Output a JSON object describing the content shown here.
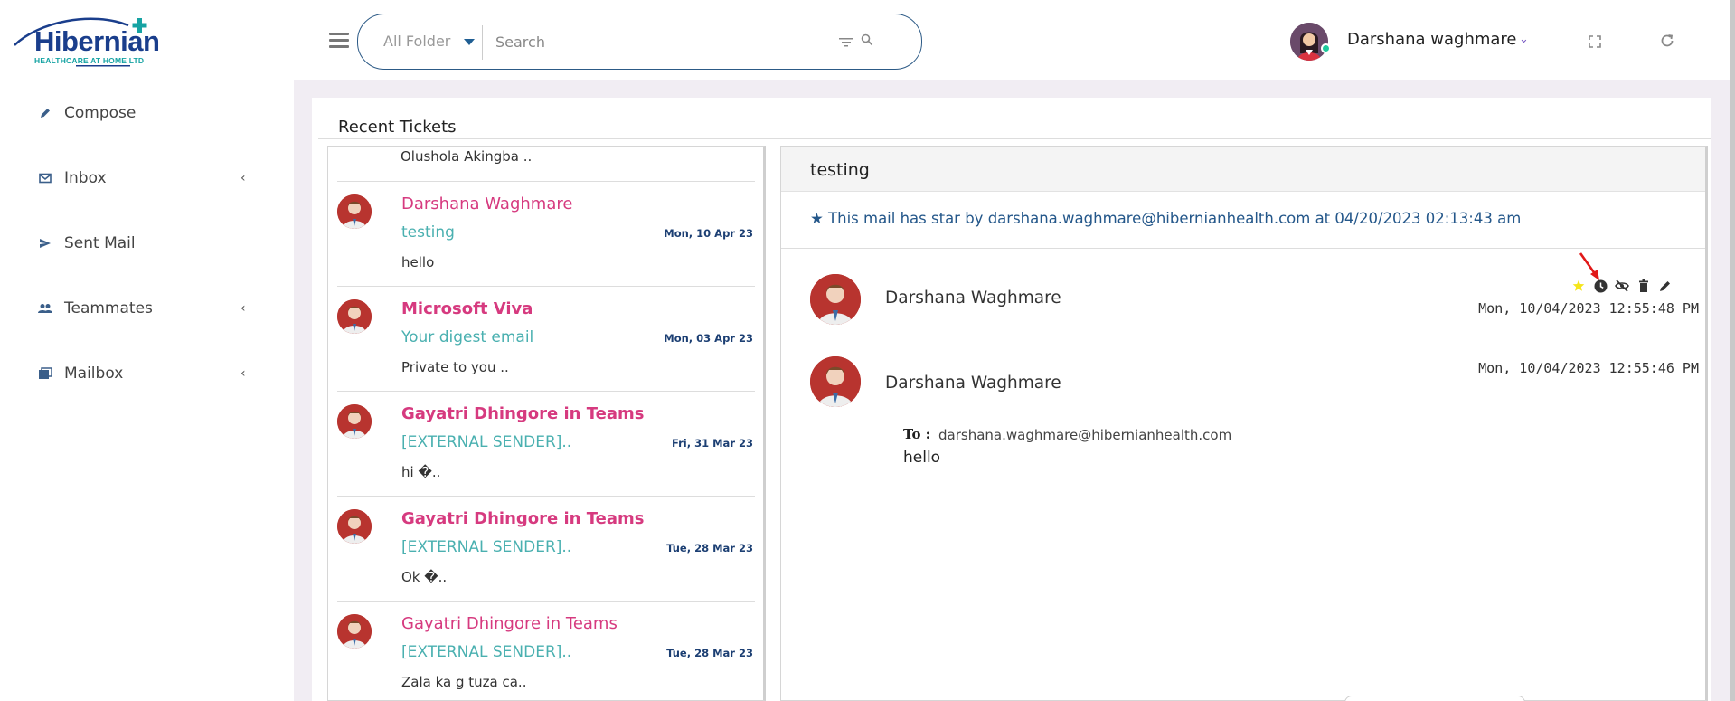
{
  "brand": {
    "logo_text": "Hibernian",
    "logo_sub": "HEALTHCARE AT HOME LTD"
  },
  "sidebar": {
    "items": [
      {
        "label": "Compose",
        "icon": "pencil-icon",
        "has_chevron": false
      },
      {
        "label": "Inbox",
        "icon": "mail-icon",
        "has_chevron": true
      },
      {
        "label": "Sent Mail",
        "icon": "send-icon",
        "has_chevron": true
      },
      {
        "label": "Teammates",
        "icon": "people-icon",
        "has_chevron": true
      },
      {
        "label": "Mailbox",
        "icon": "folders-icon",
        "has_chevron": true
      }
    ],
    "chevron": "‹"
  },
  "header": {
    "folder_select": "All Folder",
    "search_placeholder": "Search",
    "user_name": "Darshana waghmare",
    "user_caret": "⌄"
  },
  "main": {
    "title": "Recent Tickets",
    "tickets_top_preview": "Olushola Akingba ..",
    "tickets": [
      {
        "sender": "Darshana Waghmare",
        "bold": false,
        "subject": "testing",
        "date": "Mon, 10 Apr 23",
        "preview": "hello"
      },
      {
        "sender": "Microsoft Viva",
        "bold": true,
        "subject": "Your digest email",
        "date": "Mon, 03 Apr 23",
        "preview": "Private to you .."
      },
      {
        "sender": "Gayatri Dhingore in Teams",
        "bold": true,
        "subject": "[EXTERNAL SENDER]..",
        "date": "Fri, 31 Mar 23",
        "preview": "hi    �.."
      },
      {
        "sender": "Gayatri Dhingore in Teams",
        "bold": true,
        "subject": "[EXTERNAL SENDER]..",
        "date": "Tue, 28 Mar 23",
        "preview": "Ok    �.."
      },
      {
        "sender": "Gayatri Dhingore in Teams",
        "bold": false,
        "subject": "[EXTERNAL SENDER]..",
        "date": "Tue, 28 Mar 23",
        "preview": "Zala ka g tuza ca.."
      }
    ]
  },
  "detail": {
    "subject": "testing",
    "star_note": "★ This mail has star by darshana.waghmare@hibernianhealth.com at 04/20/2023 02:13:43 am",
    "messages": [
      {
        "sender": "Darshana Waghmare",
        "date": "Mon, 10/04/2023 12:55:48 PM"
      },
      {
        "sender": "Darshana Waghmare",
        "date": "Mon, 10/04/2023 12:55:46 PM"
      }
    ],
    "to_label": "To :",
    "to_value": "darshana.waghmare@hibernianhealth.com",
    "body": "hello",
    "actions": [
      "star-icon",
      "clock-icon",
      "eye-off-icon",
      "trash-icon",
      "edit-pencil-icon"
    ]
  },
  "colors": {
    "accent_pink": "#d63a7f",
    "subject_teal": "#4ab0b0",
    "date_navy": "#1c3f73",
    "search_border": "#2c5a86",
    "avatar_red": "#b8342f",
    "main_bg": "#f1edf3"
  }
}
